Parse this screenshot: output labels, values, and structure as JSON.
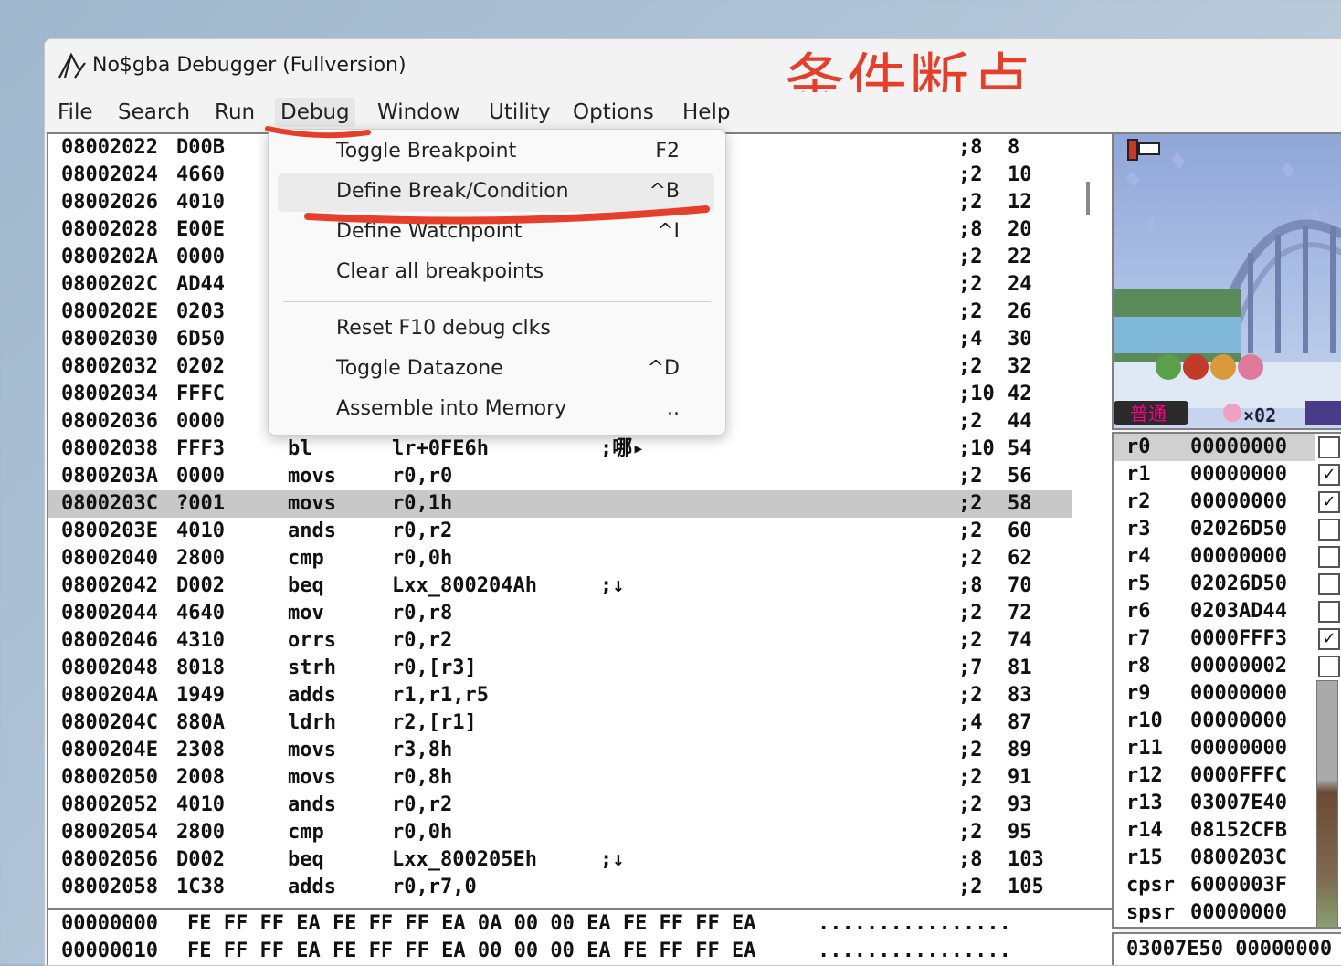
{
  "window": {
    "title": "No$gba Debugger (Fullversion)"
  },
  "annotation": {
    "text": "条件断点",
    "color": "#e53f2c"
  },
  "menubar": {
    "items": [
      "File",
      "Search",
      "Run",
      "Debug",
      "Window",
      "Utility",
      "Options",
      "Help"
    ],
    "active": "Debug"
  },
  "debug_menu": {
    "items": [
      {
        "label": "Toggle Breakpoint",
        "shortcut": "F2"
      },
      {
        "label": "Define Break/Condition",
        "shortcut": "^B"
      },
      {
        "label": "Define Watchpoint",
        "shortcut": "^I"
      },
      {
        "label": "Clear all breakpoints",
        "shortcut": ""
      },
      {
        "label": "Reset F10 debug clks",
        "shortcut": ""
      },
      {
        "label": "Toggle Datazone",
        "shortcut": "^D"
      },
      {
        "label": "Assemble into Memory",
        "shortcut": ".."
      }
    ],
    "highlighted": "Define Break/Condition"
  },
  "disassembly": {
    "rows": [
      {
        "addr": "08002022",
        "op": "D00B",
        "mn": "",
        "args": "",
        "note": "",
        "cyc": ";8",
        "tot": "8"
      },
      {
        "addr": "08002024",
        "op": "4660",
        "mn": "",
        "args": "",
        "note": "",
        "cyc": ";2",
        "tot": "10"
      },
      {
        "addr": "08002026",
        "op": "4010",
        "mn": "",
        "args": "",
        "note": "",
        "cyc": ";2",
        "tot": "12"
      },
      {
        "addr": "08002028",
        "op": "E00E",
        "mn": "",
        "args": "",
        "note": "",
        "cyc": ";8",
        "tot": "20"
      },
      {
        "addr": "0800202A",
        "op": "0000",
        "mn": "",
        "args": "",
        "note": "",
        "cyc": ";2",
        "tot": "22"
      },
      {
        "addr": "0800202C",
        "op": "AD44",
        "mn": "",
        "args": "",
        "note": "",
        "cyc": ";2",
        "tot": "24"
      },
      {
        "addr": "0800202E",
        "op": "0203",
        "mn": "",
        "args": "",
        "note": "",
        "cyc": ";2",
        "tot": "26"
      },
      {
        "addr": "08002030",
        "op": "6D50",
        "mn": "",
        "args": "",
        "note": "",
        "cyc": ";4",
        "tot": "30"
      },
      {
        "addr": "08002032",
        "op": "0202",
        "mn": "",
        "args": "",
        "note": "",
        "cyc": ";2",
        "tot": "32"
      },
      {
        "addr": "08002034",
        "op": "FFFC",
        "mn": "",
        "args": "",
        "note": "",
        "cyc": ";10",
        "tot": "42"
      },
      {
        "addr": "08002036",
        "op": "0000",
        "mn": "",
        "args": "",
        "note": "",
        "cyc": ";2",
        "tot": "44"
      },
      {
        "addr": "08002038",
        "op": "FFF3",
        "mn": "bl",
        "args": "lr+0FE6h",
        "note": ";哪▸",
        "cyc": ";10",
        "tot": "54"
      },
      {
        "addr": "0800203A",
        "op": "0000",
        "mn": "movs",
        "args": "r0,r0",
        "note": "",
        "cyc": ";2",
        "tot": "56"
      },
      {
        "addr": "0800203C",
        "op": "?001",
        "mn": "movs",
        "args": "r0,1h",
        "note": "",
        "cyc": ";2",
        "tot": "58",
        "current": true
      },
      {
        "addr": "0800203E",
        "op": "4010",
        "mn": "ands",
        "args": "r0,r2",
        "note": "",
        "cyc": ";2",
        "tot": "60"
      },
      {
        "addr": "08002040",
        "op": "2800",
        "mn": "cmp",
        "args": "r0,0h",
        "note": "",
        "cyc": ";2",
        "tot": "62"
      },
      {
        "addr": "08002042",
        "op": "D002",
        "mn": "beq",
        "args": "Lxx_800204Ah",
        "note": ";↓",
        "cyc": ";8",
        "tot": "70"
      },
      {
        "addr": "08002044",
        "op": "4640",
        "mn": "mov",
        "args": "r0,r8",
        "note": "",
        "cyc": ";2",
        "tot": "72"
      },
      {
        "addr": "08002046",
        "op": "4310",
        "mn": "orrs",
        "args": "r0,r2",
        "note": "",
        "cyc": ";2",
        "tot": "74"
      },
      {
        "addr": "08002048",
        "op": "8018",
        "mn": "strh",
        "args": "r0,[r3]",
        "note": "",
        "cyc": ";7",
        "tot": "81"
      },
      {
        "addr": "0800204A",
        "op": "1949",
        "mn": "adds",
        "args": "r1,r1,r5",
        "note": "",
        "cyc": ";2",
        "tot": "83"
      },
      {
        "addr": "0800204C",
        "op": "880A",
        "mn": "ldrh",
        "args": "r2,[r1]",
        "note": "",
        "cyc": ";4",
        "tot": "87"
      },
      {
        "addr": "0800204E",
        "op": "2308",
        "mn": "movs",
        "args": "r3,8h",
        "note": "",
        "cyc": ";2",
        "tot": "89"
      },
      {
        "addr": "08002050",
        "op": "2008",
        "mn": "movs",
        "args": "r0,8h",
        "note": "",
        "cyc": ";2",
        "tot": "91"
      },
      {
        "addr": "08002052",
        "op": "4010",
        "mn": "ands",
        "args": "r0,r2",
        "note": "",
        "cyc": ";2",
        "tot": "93"
      },
      {
        "addr": "08002054",
        "op": "2800",
        "mn": "cmp",
        "args": "r0,0h",
        "note": "",
        "cyc": ";2",
        "tot": "95"
      },
      {
        "addr": "08002056",
        "op": "D002",
        "mn": "beq",
        "args": "Lxx_800205Eh",
        "note": ";↓",
        "cyc": ";8",
        "tot": "103"
      },
      {
        "addr": "08002058",
        "op": "1C38",
        "mn": "adds",
        "args": "r0,r7,0",
        "note": "",
        "cyc": ";2",
        "tot": "105"
      }
    ]
  },
  "hexdump": {
    "rows": [
      {
        "addr": "00000000",
        "bytes": "FE FF FF EA FE FF FF EA 0A 00 00 EA FE FF FF EA",
        "ascii": "................"
      },
      {
        "addr": "00000010",
        "bytes": "FE FF FF EA FE FF FF EA 00 00 00 EA FE FF FF EA",
        "ascii": "................"
      }
    ]
  },
  "game_screen": {
    "status_text": "普通",
    "lives": "×02"
  },
  "registers": {
    "rows": [
      {
        "name": "r0",
        "value": "00000000",
        "flag": false,
        "current": true
      },
      {
        "name": "r1",
        "value": "00000000",
        "flag": true
      },
      {
        "name": "r2",
        "value": "00000000",
        "flag": true
      },
      {
        "name": "r3",
        "value": "02026D50",
        "flag": false
      },
      {
        "name": "r4",
        "value": "00000000",
        "flag": false
      },
      {
        "name": "r5",
        "value": "02026D50",
        "flag": false
      },
      {
        "name": "r6",
        "value": "0203AD44",
        "flag": false
      },
      {
        "name": "r7",
        "value": "0000FFF3",
        "flag": true
      },
      {
        "name": "r8",
        "value": "00000002",
        "flag": false
      },
      {
        "name": "r9",
        "value": "00000000"
      },
      {
        "name": "r10",
        "value": "00000000"
      },
      {
        "name": "r11",
        "value": "00000000"
      },
      {
        "name": "r12",
        "value": "0000FFFC"
      },
      {
        "name": "r13",
        "value": "03007E40"
      },
      {
        "name": "r14",
        "value": "08152CFB"
      },
      {
        "name": "r15",
        "value": "0800203C"
      },
      {
        "name": "cpsr",
        "value": "6000003F"
      },
      {
        "name": "spsr",
        "value": "00000000"
      }
    ]
  },
  "stack": {
    "line": "03007E50 00000000"
  }
}
